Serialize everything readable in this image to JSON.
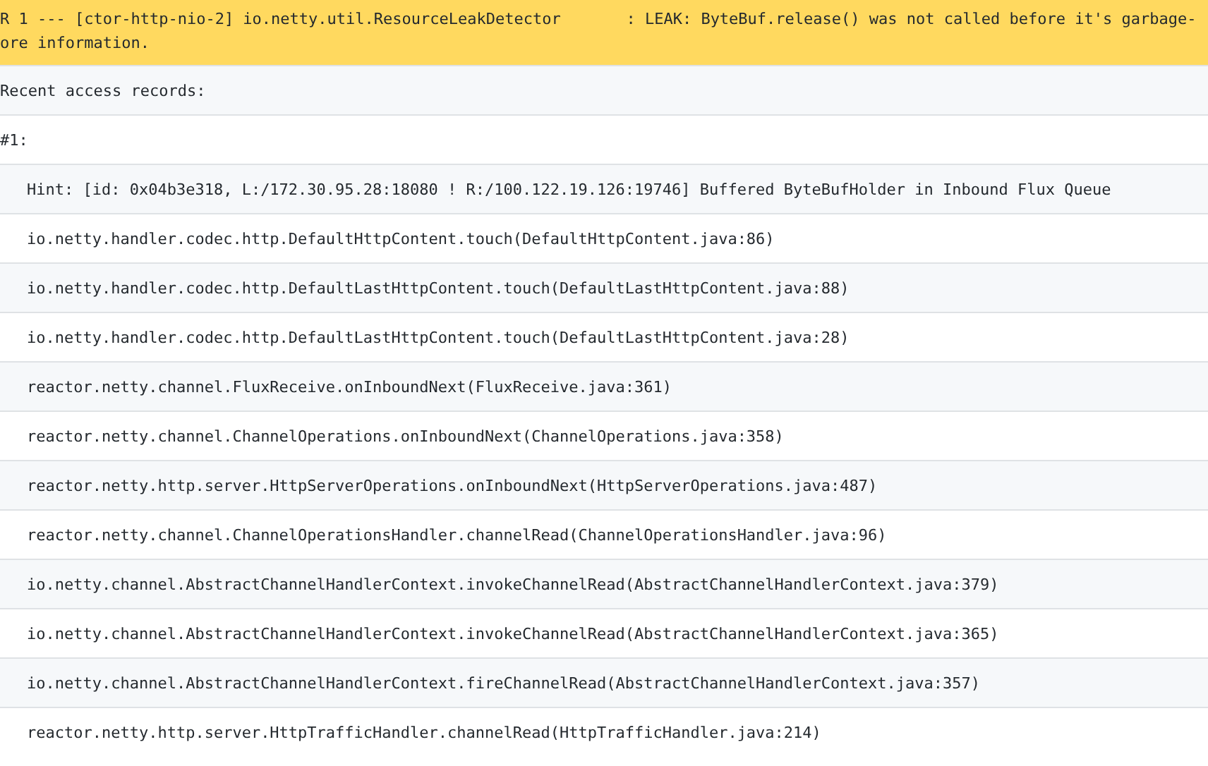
{
  "header": {
    "lines": [
      "R 1 --- [ctor-http-nio-2] io.netty.util.ResourceLeakDetector       : LEAK: ByteBuf.release() was not called before it's garbage-",
      "ore information."
    ]
  },
  "rows": [
    {
      "text": "Recent access records:",
      "kind": "plain"
    },
    {
      "text": "#1:",
      "kind": "plain"
    },
    {
      "text": "Hint: [id: 0x04b3e318, L:/172.30.95.28:18080 ! R:/100.122.19.126:19746] Buffered ByteBufHolder in Inbound Flux Queue",
      "kind": "indented"
    },
    {
      "text": "io.netty.handler.codec.http.DefaultHttpContent.touch(DefaultHttpContent.java:86)",
      "kind": "indented"
    },
    {
      "text": "io.netty.handler.codec.http.DefaultLastHttpContent.touch(DefaultLastHttpContent.java:88)",
      "kind": "indented"
    },
    {
      "text": "io.netty.handler.codec.http.DefaultLastHttpContent.touch(DefaultLastHttpContent.java:28)",
      "kind": "indented"
    },
    {
      "text": "reactor.netty.channel.FluxReceive.onInboundNext(FluxReceive.java:361)",
      "kind": "indented"
    },
    {
      "text": "reactor.netty.channel.ChannelOperations.onInboundNext(ChannelOperations.java:358)",
      "kind": "indented"
    },
    {
      "text": "reactor.netty.http.server.HttpServerOperations.onInboundNext(HttpServerOperations.java:487)",
      "kind": "indented"
    },
    {
      "text": "reactor.netty.channel.ChannelOperationsHandler.channelRead(ChannelOperationsHandler.java:96)",
      "kind": "indented"
    },
    {
      "text": "io.netty.channel.AbstractChannelHandlerContext.invokeChannelRead(AbstractChannelHandlerContext.java:379)",
      "kind": "indented"
    },
    {
      "text": "io.netty.channel.AbstractChannelHandlerContext.invokeChannelRead(AbstractChannelHandlerContext.java:365)",
      "kind": "indented"
    },
    {
      "text": "io.netty.channel.AbstractChannelHandlerContext.fireChannelRead(AbstractChannelHandlerContext.java:357)",
      "kind": "indented"
    },
    {
      "text": "reactor.netty.http.server.HttpTrafficHandler.channelRead(HttpTrafficHandler.java:214)",
      "kind": "indented"
    }
  ]
}
